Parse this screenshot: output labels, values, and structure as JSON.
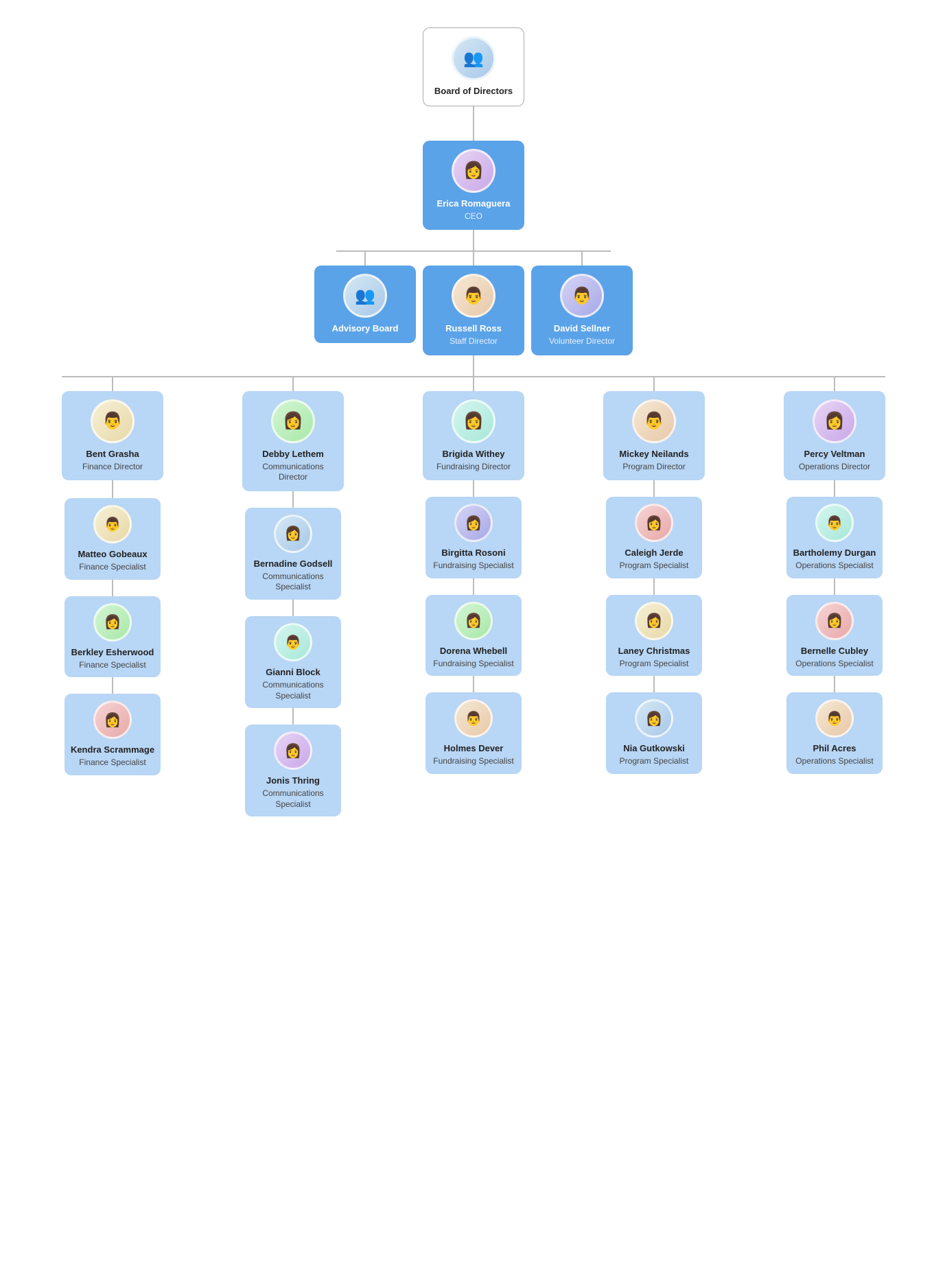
{
  "nodes": {
    "board": {
      "name": "Board of Directors",
      "title": "",
      "type": "white",
      "avatar_color": "av-1"
    },
    "ceo": {
      "name": "Erica Romaguera",
      "title": "CEO",
      "type": "blue",
      "avatar_color": "av-5"
    },
    "advisory": {
      "name": "Advisory Board",
      "title": "",
      "type": "blue",
      "avatar_color": "av-1"
    },
    "russell": {
      "name": "Russell Ross",
      "title": "Staff Director",
      "type": "blue",
      "avatar_color": "av-7"
    },
    "david": {
      "name": "David Sellner",
      "title": "Volunteer Director",
      "type": "blue",
      "avatar_color": "av-8"
    },
    "bent": {
      "name": "Bent Grasha",
      "title": "Finance Director",
      "type": "light-blue",
      "avatar_color": "av-4"
    },
    "debby": {
      "name": "Debby Lethem",
      "title": "Communications Director",
      "type": "light-blue",
      "avatar_color": "av-3"
    },
    "brigida": {
      "name": "Brigida Withey",
      "title": "Fundraising Director",
      "type": "light-blue",
      "avatar_color": "av-6"
    },
    "mickey": {
      "name": "Mickey Neilands",
      "title": "Program Director",
      "type": "light-blue",
      "avatar_color": "av-7"
    },
    "percy": {
      "name": "Percy Veltman",
      "title": "Operations Director",
      "type": "light-blue",
      "avatar_color": "av-5"
    },
    "matteo": {
      "name": "Matteo Gobeaux",
      "title": "Finance Specialist",
      "avatar_color": "av-4"
    },
    "berkley": {
      "name": "Berkley Esherwood",
      "title": "Finance Specialist",
      "avatar_color": "av-3"
    },
    "kendra": {
      "name": "Kendra Scrammage",
      "title": "Finance Specialist",
      "avatar_color": "av-2"
    },
    "bernadine": {
      "name": "Bernadine Godsell",
      "title": "Communications Specialist",
      "avatar_color": "av-1"
    },
    "gianni": {
      "name": "Gianni Block",
      "title": "Communications Specialist",
      "avatar_color": "av-6"
    },
    "jonis": {
      "name": "Jonis Thring",
      "title": "Communications Specialist",
      "avatar_color": "av-5"
    },
    "birgitta": {
      "name": "Birgitta Rosoni",
      "title": "Fundraising Specialist",
      "avatar_color": "av-8"
    },
    "dorena": {
      "name": "Dorena Whebell",
      "title": "Fundraising Specialist",
      "avatar_color": "av-3"
    },
    "holmes": {
      "name": "Holmes Dever",
      "title": "Fundraising Specialist",
      "avatar_color": "av-7"
    },
    "caleigh": {
      "name": "Caleigh Jerde",
      "title": "Program Specialist",
      "avatar_color": "av-2"
    },
    "laney": {
      "name": "Laney Christmas",
      "title": "Program Specialist",
      "avatar_color": "av-4"
    },
    "nia": {
      "name": "Nia Gutkowski",
      "title": "Program Specialist",
      "avatar_color": "av-1"
    },
    "bartholemy": {
      "name": "Bartholemy Durgan",
      "title": "Operations Specialist",
      "avatar_color": "av-6"
    },
    "bernelle": {
      "name": "Bernelle Cubley",
      "title": "Operations Specialist",
      "avatar_color": "av-2"
    },
    "phil": {
      "name": "Phil Acres",
      "title": "Operations Specialist",
      "avatar_color": "av-7"
    }
  }
}
